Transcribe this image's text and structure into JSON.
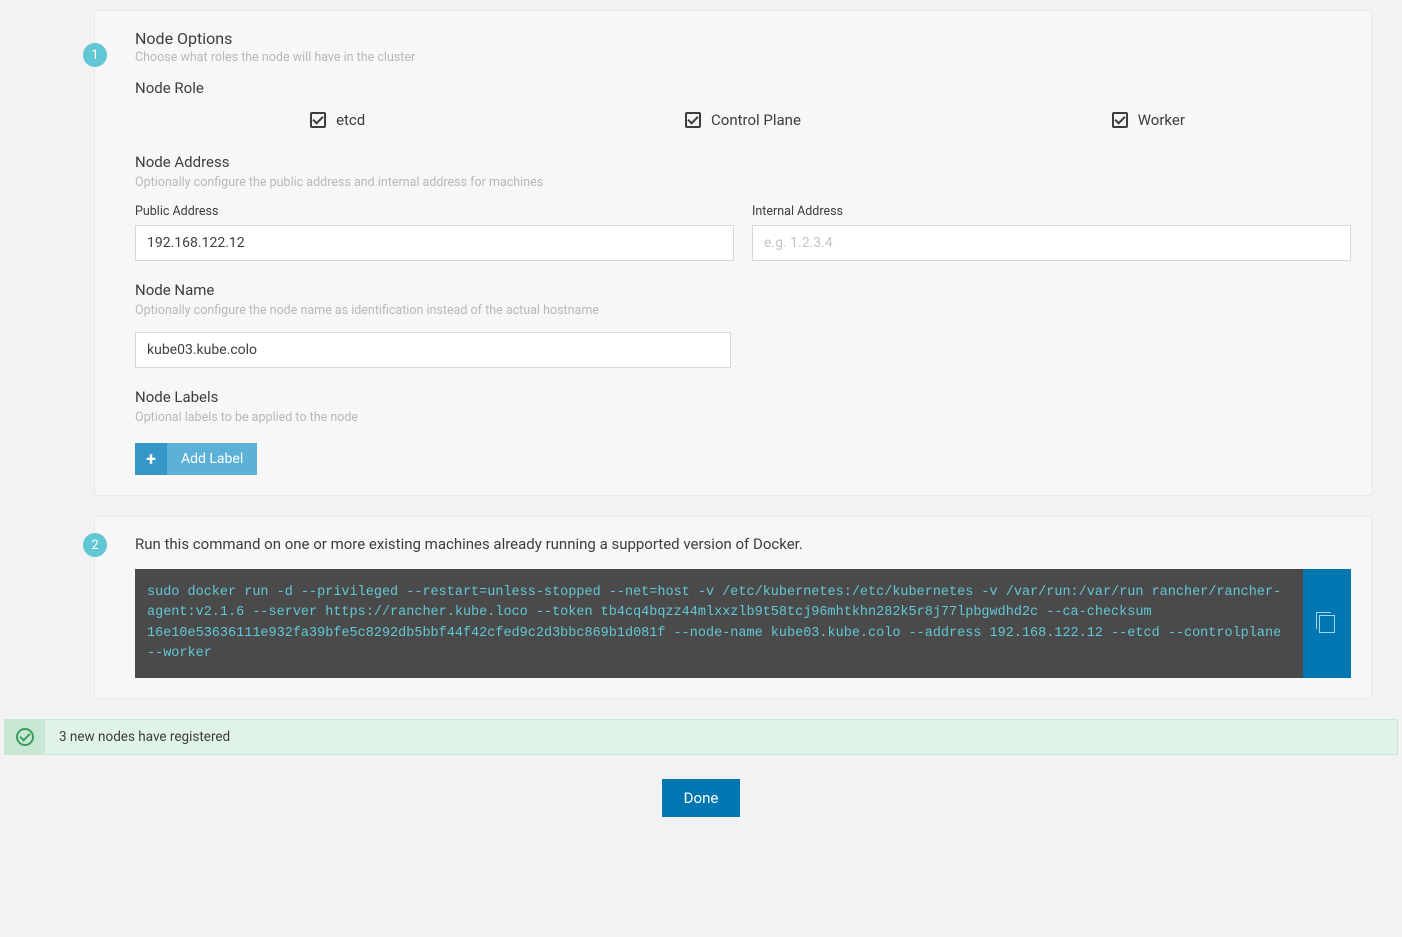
{
  "step1": {
    "number": "1",
    "title": "Node Options",
    "subtitle": "Choose what roles the node will have in the cluster",
    "node_role": {
      "heading": "Node Role",
      "etcd": "etcd",
      "control_plane": "Control Plane",
      "worker": "Worker"
    },
    "node_address": {
      "heading": "Node Address",
      "subtitle": "Optionally configure the public address and internal address for machines",
      "public_label": "Public Address",
      "public_value": "192.168.122.12",
      "internal_label": "Internal Address",
      "internal_placeholder": "e.g. 1.2.3.4"
    },
    "node_name": {
      "heading": "Node Name",
      "subtitle": "Optionally configure the node name as identification instead of the actual hostname",
      "value": "kube03.kube.colo"
    },
    "node_labels": {
      "heading": "Node Labels",
      "subtitle": "Optional labels to be applied to the node",
      "add_label": "Add Label"
    }
  },
  "step2": {
    "number": "2",
    "instruction": "Run this command on one or more existing machines already running a supported version of Docker.",
    "command": "sudo docker run -d --privileged --restart=unless-stopped --net=host -v /etc/kubernetes:/etc/kubernetes -v /var/run:/var/run rancher/rancher-agent:v2.1.6 --server https://rancher.kube.loco --token tb4cq4bqzz44mlxxzlb9t58tcj96mhtkhn282k5r8j77lpbgwdhd2c --ca-checksum 16e10e53636111e932fa39bfe5c8292db5bbf44f42cfed9c2d3bbc869b1d081f --node-name kube03.kube.colo --address 192.168.122.12 --etcd --controlplane --worker"
  },
  "status": {
    "message": "3 new nodes have registered"
  },
  "done_label": "Done"
}
